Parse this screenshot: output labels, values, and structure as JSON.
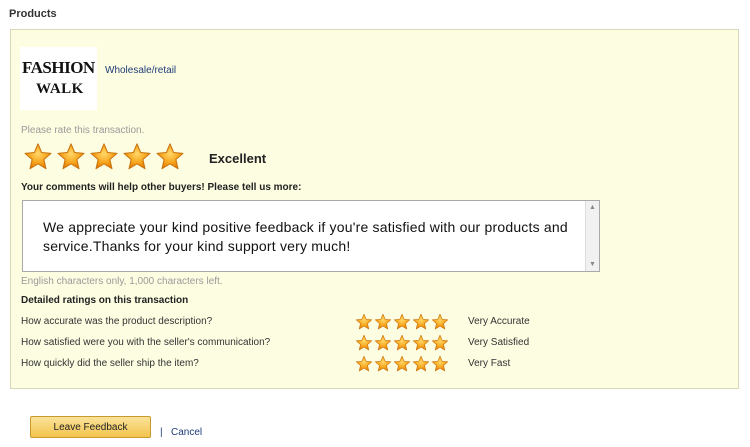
{
  "section_title": "Products",
  "store": {
    "logo_line1": "FASHION",
    "logo_line2": "WALK",
    "link_label": "Wholesale/retail"
  },
  "rating": {
    "prompt": "Please rate this transaction.",
    "stars": 5,
    "max_stars": 5,
    "label": "Excellent"
  },
  "comments": {
    "label": "Your comments will help other buyers! Please tell us more:",
    "value": "We appreciate your kind positive feedback if you're satisfied with our products and service.Thanks for your kind support very much!",
    "char_hint": "English characters only, 1,000 characters left."
  },
  "details": {
    "title": "Detailed ratings on this transaction",
    "rows": [
      {
        "question": "How accurate was the product description?",
        "stars": 5,
        "value": "Very Accurate"
      },
      {
        "question": "How satisfied were you with the seller's communication?",
        "stars": 5,
        "value": "Very Satisfied"
      },
      {
        "question": "How quickly did the seller ship the item?",
        "stars": 5,
        "value": "Very Fast"
      }
    ]
  },
  "actions": {
    "submit_label": "Leave Feedback",
    "separator": "|",
    "cancel_label": "Cancel"
  },
  "colors": {
    "panel_bg": "#fdfde2",
    "star_fill": "#f7a51c",
    "link": "#1f3c78",
    "button": "#f3c44e"
  }
}
